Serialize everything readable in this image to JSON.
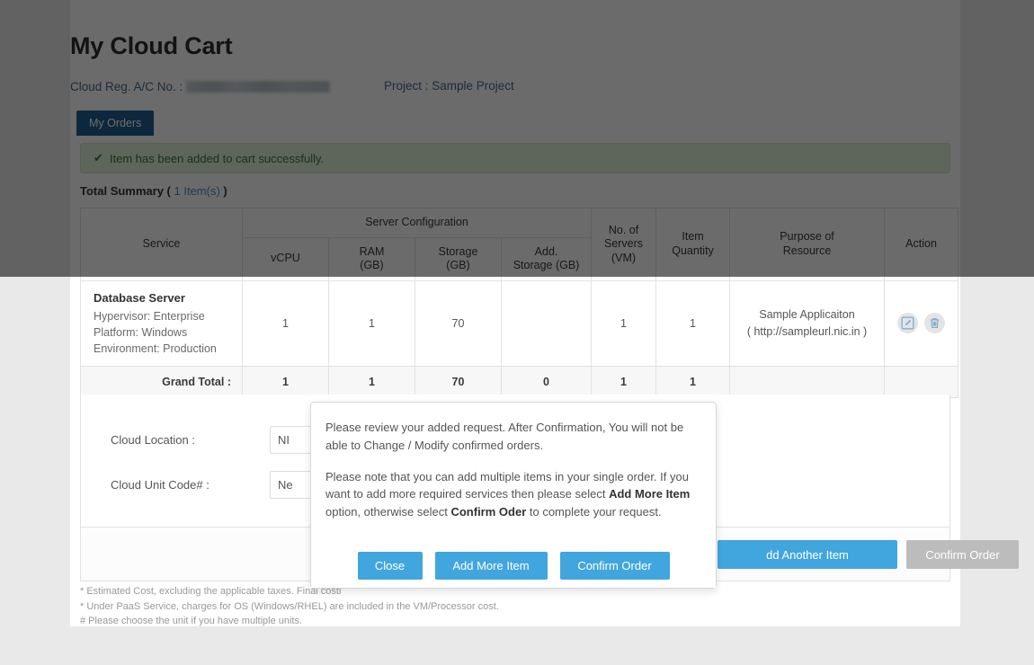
{
  "page": {
    "title": "My Cloud Cart",
    "account_label": "Cloud Reg. A/C No. :",
    "account_value_redacted": "",
    "project_label": "Project : Sample Project"
  },
  "tabs": [
    {
      "label": "My Orders",
      "active": true
    }
  ],
  "alert": {
    "icon": "check-icon",
    "glyph": "✔",
    "message": "Item has been added to cart successfully.",
    "background": "#dff0d8",
    "text_color": "#3c763d"
  },
  "summary": {
    "label": "Total Summary (",
    "count": " 1 Item(s) ",
    "label_end": ")"
  },
  "table": {
    "group_header": "Server Configuration",
    "headers": {
      "service": "Service",
      "vcpu": "vCPU",
      "ram": "RAM\n(GB)",
      "ram_l1": "RAM",
      "ram_l2": "(GB)",
      "storage_l1": "Storage",
      "storage_l2": "(GB)",
      "addstorage_l1": "Add.",
      "addstorage_l2": "Storage (GB)",
      "servers_l1": "No. of",
      "servers_l2": "Servers",
      "servers_l3": "(VM)",
      "qty_l1": "Item",
      "qty_l2": "Quantity",
      "purpose_l1": "Purpose of",
      "purpose_l2": "Resource",
      "action": "Action"
    },
    "rows": [
      {
        "service_name": "Database Server",
        "service_detail_1": "Hypervisor: Enterprise",
        "service_detail_2": "Platform: Windows",
        "service_detail_3": "Environment: Production",
        "vcpu": "1",
        "ram": "1",
        "storage": "70",
        "add_storage": "",
        "servers": "1",
        "quantity": "1",
        "purpose_name": "Sample Applicaiton",
        "purpose_url": "( http://sampleurl.nic.in )",
        "actions": [
          "edit-icon",
          "delete-icon"
        ]
      }
    ],
    "grand_total": {
      "label": "Grand Total :",
      "vcpu": "1",
      "ram": "1",
      "storage": "70",
      "add_storage": "0",
      "servers": "1",
      "quantity": "1"
    }
  },
  "form": {
    "cloud_location": {
      "label": "Cloud Location :",
      "value": "NI"
    },
    "cloud_unit_code": {
      "label": "Cloud Unit Code# :",
      "value": "Ne"
    }
  },
  "footer_buttons": {
    "add_another_item": "dd Another Item",
    "confirm_order": "Confirm Order"
  },
  "notes": [
    "* Estimated Cost, excluding the applicable taxes. Final costi",
    "* Under PaaS Service, charges for OS (Windows/RHEL) are included in the VM/Processor cost.",
    "# Please choose the unit if you have multiple units."
  ],
  "modal": {
    "paragraph_1": "Please review your added request. After Confirmation, You will not be able to Change / Modify confirmed orders.",
    "paragraph_2_a": "Please note that you can add multiple items in your single order. If you want to add more required services then please select ",
    "paragraph_2_bold_1": "Add More Item",
    "paragraph_2_b": " option, otherwise select ",
    "paragraph_2_bold_2": "Confirm Oder",
    "paragraph_2_c": " to complete your request.",
    "buttons": {
      "close": "Close",
      "add_more_item": "Add More Item",
      "confirm_order": "Confirm Order"
    }
  },
  "colors": {
    "accent_blue": "#41a6de",
    "tab_blue": "#1f6090",
    "link_blue": "#4b8fbe",
    "alert_green_bg": "#dff0d8",
    "disabled_grey": "#bcbcbc"
  }
}
